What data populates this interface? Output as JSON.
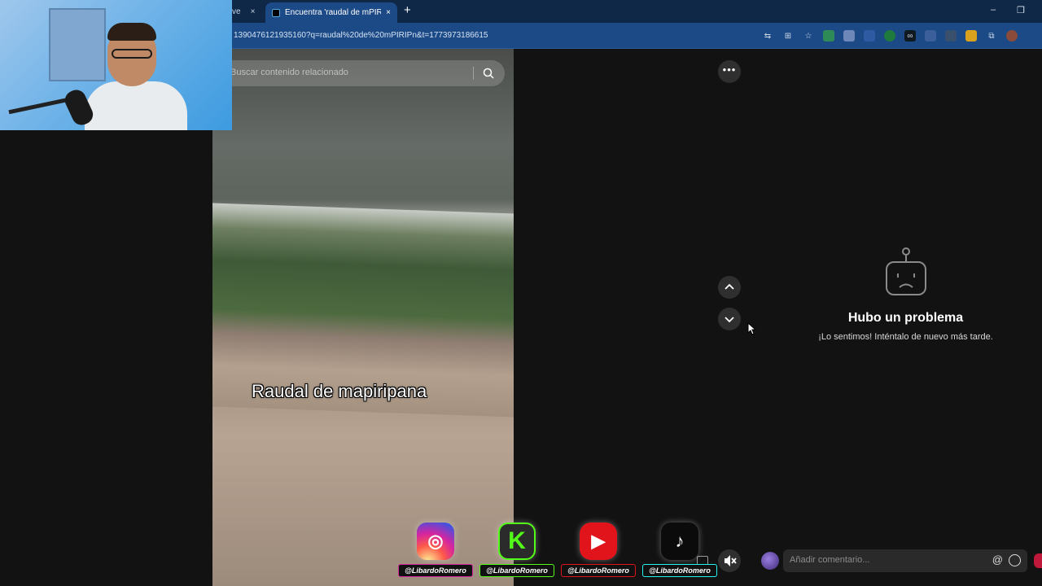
{
  "browser": {
    "prev_tab_label": "ve",
    "active_tab_title": "Encuentra 'raudal de mPIRIPn' -",
    "new_tab_symbol": "+",
    "close_symbol": "×",
    "minimize_symbol": "–",
    "restore_symbol": "❐",
    "url": "1390476121935160?q=raudal%20de%20mPIRIPn&t=1773973186615"
  },
  "video": {
    "search_placeholder": "Buscar contenido relacionado",
    "caption": "Raudal de mapiripana"
  },
  "controls": {
    "more_label": "•••"
  },
  "error": {
    "title": "Hubo un problema",
    "message": "¡Lo sentimos! Inténtalo de nuevo más tarde."
  },
  "comment": {
    "placeholder": "Añadir comentario...",
    "mention_symbol": "@"
  },
  "socials": [
    {
      "network": "instagram",
      "icon": "instagram-icon",
      "glyph": "◎",
      "handle": "@LibardoRomero"
    },
    {
      "network": "kick",
      "icon": "kick-icon",
      "glyph": "K",
      "handle": "@LibardoRomero"
    },
    {
      "network": "youtube",
      "icon": "youtube-icon",
      "glyph": "▶",
      "handle": "@LibardoRomero"
    },
    {
      "network": "tiktok",
      "icon": "tiktok-icon",
      "glyph": "♪",
      "handle": "@LibardoRomero"
    }
  ],
  "colors": {
    "tabbar": "#0f2847",
    "addressbar": "#1c4a86",
    "page_bg": "#121212",
    "accent_post": "#c0183a"
  }
}
